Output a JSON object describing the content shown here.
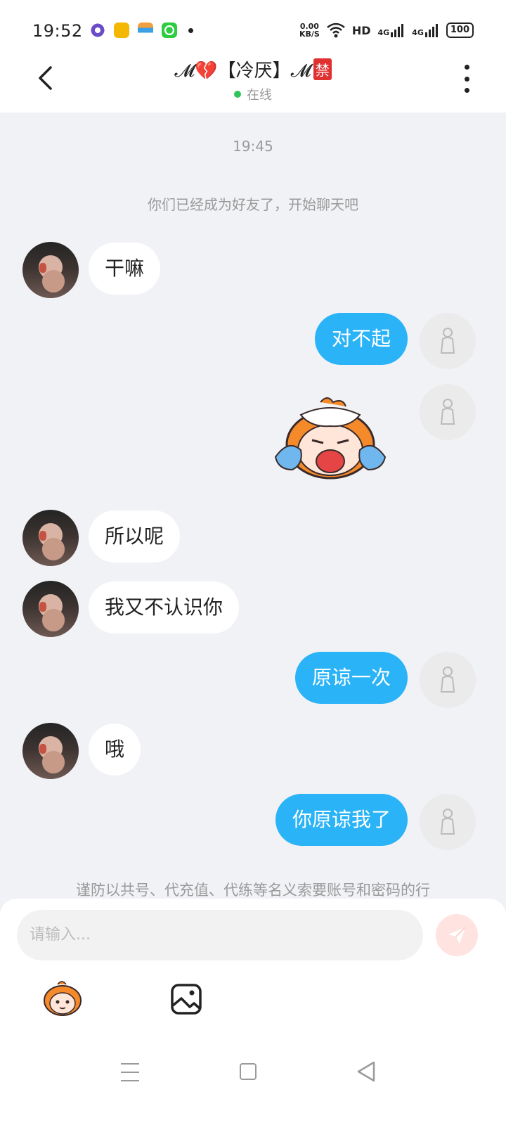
{
  "status_bar": {
    "time": "19:52",
    "net_speed_value": "0.00",
    "net_speed_unit": "KB/S",
    "hd": "HD",
    "network_1": "4G",
    "network_2": "4G",
    "battery": "100"
  },
  "header": {
    "title": "𝓜💔【冷厌】𝓜",
    "ban_badge": "禁",
    "status": "在线"
  },
  "chat": {
    "timestamp": "19:45",
    "system_message": "你们已经成为好友了，开始聊天吧",
    "messages": [
      {
        "side": "left",
        "text": "干嘛"
      },
      {
        "side": "right",
        "text": "对不起"
      },
      {
        "side": "right",
        "sticker": "crying-mascot-sticker"
      },
      {
        "side": "left",
        "text": "所以呢"
      },
      {
        "side": "left",
        "text": "我又不认识你"
      },
      {
        "side": "right",
        "text": "原谅一次"
      },
      {
        "side": "left",
        "text": "哦"
      },
      {
        "side": "right",
        "text": "你原谅我了"
      }
    ],
    "warning": "谨防以共号、代充值、代练等名义索要账号和密码的行"
  },
  "composer": {
    "placeholder": "请输入..."
  },
  "colors": {
    "accent": "#2ab3f7",
    "online": "#2fc45b",
    "background": "#f1f2f6"
  }
}
